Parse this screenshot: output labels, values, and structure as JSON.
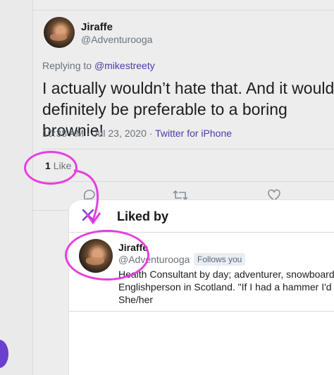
{
  "tweet": {
    "display_name": "Jiraffe",
    "handle": "@Adventurooga",
    "replying_prefix": "Replying to",
    "replying_handle": "@mikestreety",
    "body": "I actually wouldn’t hate that. And it would definitely be preferable to a boring brownie!",
    "time_date": "10:38 AM · Jul 23, 2020",
    "separator": "·",
    "source": "Twitter for iPhone",
    "like_count": "1",
    "like_label": "Like"
  },
  "actions": {
    "reply_icon": "reply-icon",
    "retweet_icon": "retweet-icon",
    "like_icon": "heart-icon"
  },
  "modal": {
    "title": "Liked by",
    "close_icon": "close-icon",
    "user": {
      "display_name": "Jiraffe",
      "handle": "@Adventurooga",
      "follows_badge": "Follows you",
      "bio_line1": "Health Consultant by day; adventurer, snowboard",
      "bio_line2": "Englishperson in Scotland. \"If I had a hammer I'd",
      "bio_line3": "She/her"
    }
  },
  "colors": {
    "accent_link": "#4b3aa8",
    "annotation": "#e63ee0",
    "close_x": "#6b3fd0"
  }
}
